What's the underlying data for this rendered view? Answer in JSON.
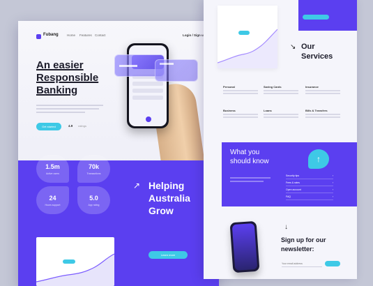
{
  "left_page": {
    "brand": "Fubang",
    "nav": [
      "Home",
      "Features",
      "Contact"
    ],
    "nav_cta": "Login / Sign up",
    "hero_title": [
      "An easier",
      "Responsible",
      "Banking"
    ],
    "hero_cta": "Get started",
    "rating_value": "4.9",
    "rating_label": "ratings",
    "stats": [
      {
        "value": "1.5m",
        "label": "Active users"
      },
      {
        "value": "70k",
        "label": "Transactions"
      },
      {
        "value": "24",
        "label": "Hours support"
      },
      {
        "value": "5.0",
        "label": "App rating"
      }
    ],
    "helping_title": [
      "Helping",
      "Australia",
      "Grow"
    ],
    "learn_more": "Learn more"
  },
  "right_page": {
    "services_title": [
      "Our",
      "Services"
    ],
    "services": [
      "Personal",
      "Saving Cards",
      "Insurance",
      "Business",
      "Loans",
      "Bills & Transfers"
    ],
    "know_title": [
      "What you",
      "should know"
    ],
    "know_items": [
      "Security tips",
      "Fees & rates",
      "Open account",
      "FAQ"
    ],
    "newsletter_title": [
      "Sign up for our",
      "newsletter:"
    ],
    "newsletter_placeholder": "Your email address",
    "newsletter_btn": ""
  },
  "colors": {
    "brand_purple": "#5b3ff0",
    "accent_cyan": "#3ec9e6"
  }
}
